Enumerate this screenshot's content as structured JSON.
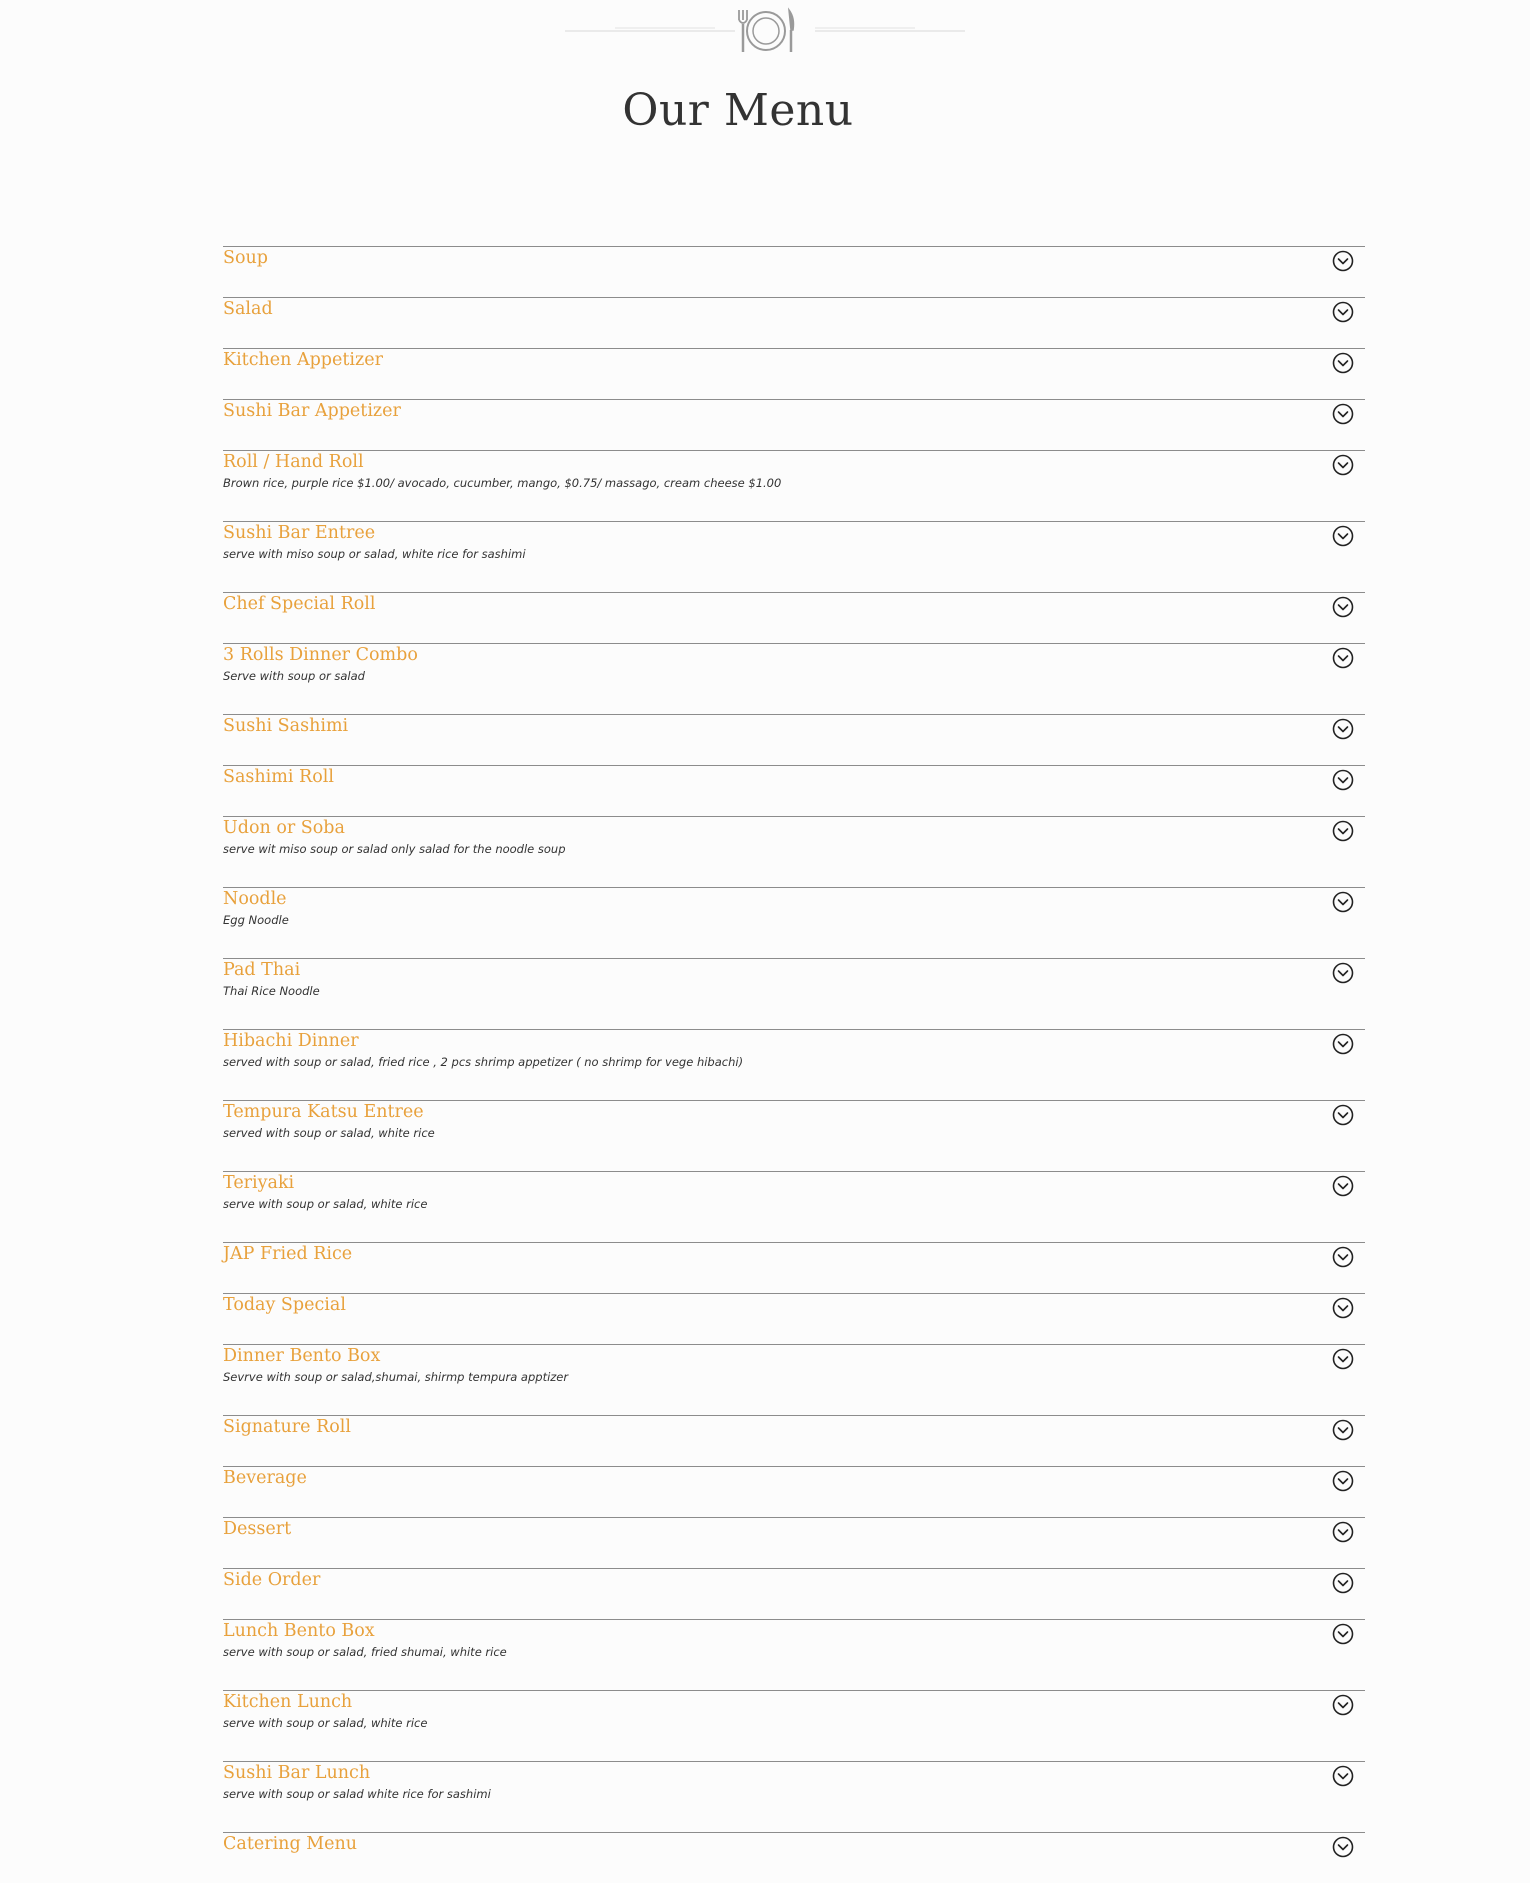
{
  "page": {
    "title": "Our Menu",
    "accent_color": "#e8a13c",
    "text_color": "#333333",
    "divider_color": "#8c8c8c",
    "ornament_icon": "plate-fork-knife-icon",
    "toggle_icon": "chevron-down-circle-icon"
  },
  "menu": {
    "items": [
      {
        "title": "Soup",
        "desc": ""
      },
      {
        "title": "Salad",
        "desc": ""
      },
      {
        "title": "Kitchen Appetizer",
        "desc": ""
      },
      {
        "title": "Sushi Bar Appetizer",
        "desc": ""
      },
      {
        "title": "Roll / Hand Roll",
        "desc": "Brown rice, purple rice $1.00/ avocado, cucumber, mango, $0.75/ massago, cream cheese $1.00"
      },
      {
        "title": "Sushi Bar Entree",
        "desc": "serve with miso soup or salad, white rice for sashimi"
      },
      {
        "title": "Chef Special Roll",
        "desc": ""
      },
      {
        "title": "3 Rolls Dinner Combo",
        "desc": "Serve with soup or salad"
      },
      {
        "title": "Sushi Sashimi",
        "desc": ""
      },
      {
        "title": "Sashimi Roll",
        "desc": ""
      },
      {
        "title": "Udon or Soba",
        "desc": "serve wit miso soup or salad only salad for the noodle soup"
      },
      {
        "title": "Noodle",
        "desc": "Egg Noodle"
      },
      {
        "title": "Pad Thai",
        "desc": "Thai Rice Noodle"
      },
      {
        "title": "Hibachi Dinner",
        "desc": "served with soup or salad, fried rice , 2 pcs shrimp appetizer ( no shrimp for vege hibachi)"
      },
      {
        "title": "Tempura Katsu Entree",
        "desc": "served with soup or salad, white rice"
      },
      {
        "title": "Teriyaki",
        "desc": "serve with soup or salad, white rice"
      },
      {
        "title": "JAP Fried Rice",
        "desc": ""
      },
      {
        "title": "Today Special",
        "desc": ""
      },
      {
        "title": "Dinner Bento Box",
        "desc": "Sevrve with soup or salad,shumai, shirmp tempura apptizer"
      },
      {
        "title": "Signature Roll",
        "desc": ""
      },
      {
        "title": "Beverage",
        "desc": ""
      },
      {
        "title": "Dessert",
        "desc": ""
      },
      {
        "title": "Side Order",
        "desc": ""
      },
      {
        "title": "Lunch Bento Box",
        "desc": "serve with soup or salad, fried shumai, white rice"
      },
      {
        "title": "Kitchen Lunch",
        "desc": "serve with soup or salad, white rice"
      },
      {
        "title": "Sushi Bar Lunch",
        "desc": "serve with soup or salad white rice for sashimi"
      },
      {
        "title": "Catering Menu",
        "desc": ""
      }
    ]
  }
}
